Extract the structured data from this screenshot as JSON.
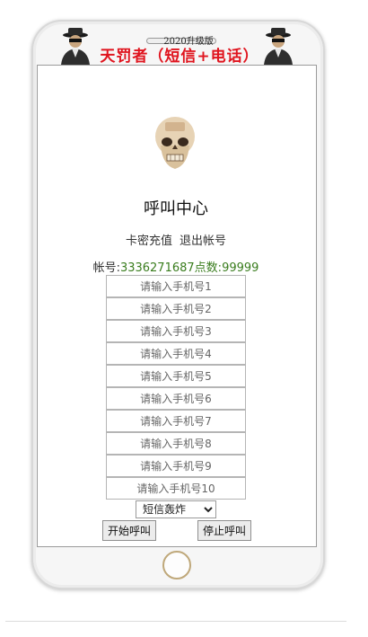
{
  "header": {
    "year_label_prefix": "2020",
    "year_label_suffix": "升级版",
    "banner": "天罚者（短信+电话）"
  },
  "main": {
    "title": "呼叫中心",
    "links": [
      "卡密充值",
      "退出帐号"
    ],
    "account_label": "帐号:",
    "account_value": "3336271687",
    "points_label": "点数:",
    "points_value": "99999"
  },
  "phone_inputs": [
    {
      "placeholder": "请输入手机号1"
    },
    {
      "placeholder": "请输入手机号2"
    },
    {
      "placeholder": "请输入手机号3"
    },
    {
      "placeholder": "请输入手机号4"
    },
    {
      "placeholder": "请输入手机号5"
    },
    {
      "placeholder": "请输入手机号6"
    },
    {
      "placeholder": "请输入手机号7"
    },
    {
      "placeholder": "请输入手机号8"
    },
    {
      "placeholder": "请输入手机号9"
    },
    {
      "placeholder": "请输入手机号10"
    }
  ],
  "mode_select": {
    "selected": "短信轰炸"
  },
  "buttons": {
    "start": "开始呼叫",
    "stop": "停止呼叫"
  },
  "colors": {
    "banner": "#e0141e",
    "account_value": "#3a7d1e"
  }
}
